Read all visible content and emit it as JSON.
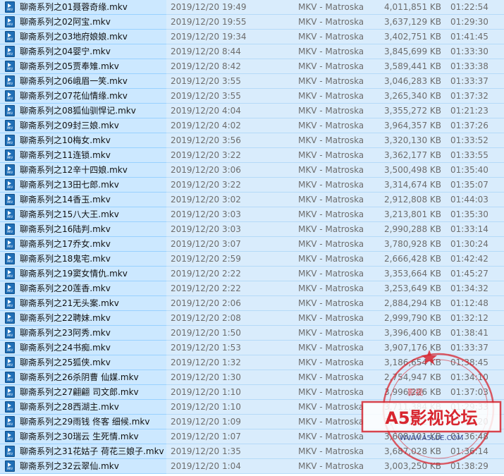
{
  "files": [
    {
      "name": "聊斋系列之01聂蓉奇缘.mkv",
      "date": "2019/12/20 19:49",
      "type": "MKV - Matroska",
      "size": "4,011,851 KB",
      "duration": "01:22:54"
    },
    {
      "name": "聊斋系列之02阿宝.mkv",
      "date": "2019/12/20 19:55",
      "type": "MKV - Matroska",
      "size": "3,637,129 KB",
      "duration": "01:29:30"
    },
    {
      "name": "聊斋系列之03地府娘娘.mkv",
      "date": "2019/12/20 19:34",
      "type": "MKV - Matroska",
      "size": "3,402,751 KB",
      "duration": "01:41:45"
    },
    {
      "name": "聊斋系列之04婴宁.mkv",
      "date": "2019/12/20 8:44",
      "type": "MKV - Matroska",
      "size": "3,845,699 KB",
      "duration": "01:33:30"
    },
    {
      "name": "聊斋系列之05贾奉雉.mkv",
      "date": "2019/12/20 8:42",
      "type": "MKV - Matroska",
      "size": "3,589,441 KB",
      "duration": "01:33:38"
    },
    {
      "name": "聊斋系列之06峨眉一笑.mkv",
      "date": "2019/12/20 3:55",
      "type": "MKV - Matroska",
      "size": "3,046,283 KB",
      "duration": "01:33:37"
    },
    {
      "name": "聊斋系列之07花仙情缘.mkv",
      "date": "2019/12/20 3:55",
      "type": "MKV - Matroska",
      "size": "3,265,340 KB",
      "duration": "01:37:32"
    },
    {
      "name": "聊斋系列之08狐仙驯悍记.mkv",
      "date": "2019/12/20 4:04",
      "type": "MKV - Matroska",
      "size": "3,355,272 KB",
      "duration": "01:21:23"
    },
    {
      "name": "聊斋系列之09封三娘.mkv",
      "date": "2019/12/20 4:02",
      "type": "MKV - Matroska",
      "size": "3,964,357 KB",
      "duration": "01:37:26"
    },
    {
      "name": "聊斋系列之10梅女.mkv",
      "date": "2019/12/20 3:56",
      "type": "MKV - Matroska",
      "size": "3,320,130 KB",
      "duration": "01:33:52"
    },
    {
      "name": "聊斋系列之11连锁.mkv",
      "date": "2019/12/20 3:22",
      "type": "MKV - Matroska",
      "size": "3,362,177 KB",
      "duration": "01:33:55"
    },
    {
      "name": "聊斋系列之12辛十四娘.mkv",
      "date": "2019/12/20 3:06",
      "type": "MKV - Matroska",
      "size": "3,500,498 KB",
      "duration": "01:35:40"
    },
    {
      "name": "聊斋系列之13田七郎.mkv",
      "date": "2019/12/20 3:22",
      "type": "MKV - Matroska",
      "size": "3,314,674 KB",
      "duration": "01:35:07"
    },
    {
      "name": "聊斋系列之14香玉.mkv",
      "date": "2019/12/20 3:02",
      "type": "MKV - Matroska",
      "size": "2,912,808 KB",
      "duration": "01:44:03"
    },
    {
      "name": "聊斋系列之15八大王.mkv",
      "date": "2019/12/20 3:03",
      "type": "MKV - Matroska",
      "size": "3,213,801 KB",
      "duration": "01:35:30"
    },
    {
      "name": "聊斋系列之16陆判.mkv",
      "date": "2019/12/20 3:03",
      "type": "MKV - Matroska",
      "size": "2,990,288 KB",
      "duration": "01:33:14"
    },
    {
      "name": "聊斋系列之17乔女.mkv",
      "date": "2019/12/20 3:07",
      "type": "MKV - Matroska",
      "size": "3,780,928 KB",
      "duration": "01:30:24"
    },
    {
      "name": "聊斋系列之18鬼宅.mkv",
      "date": "2019/12/20 2:59",
      "type": "MKV - Matroska",
      "size": "2,666,428 KB",
      "duration": "01:42:42"
    },
    {
      "name": "聊斋系列之19窦女情仇.mkv",
      "date": "2019/12/20 2:22",
      "type": "MKV - Matroska",
      "size": "3,353,664 KB",
      "duration": "01:45:27"
    },
    {
      "name": "聊斋系列之20莲香.mkv",
      "date": "2019/12/20 2:22",
      "type": "MKV - Matroska",
      "size": "3,253,649 KB",
      "duration": "01:34:32"
    },
    {
      "name": "聊斋系列之21无头案.mkv",
      "date": "2019/12/20 2:06",
      "type": "MKV - Matroska",
      "size": "2,884,294 KB",
      "duration": "01:12:48"
    },
    {
      "name": "聊斋系列之22聘妹.mkv",
      "date": "2019/12/20 2:08",
      "type": "MKV - Matroska",
      "size": "2,999,790 KB",
      "duration": "01:32:12"
    },
    {
      "name": "聊斋系列之23阿秀.mkv",
      "date": "2019/12/20 1:50",
      "type": "MKV - Matroska",
      "size": "3,396,400 KB",
      "duration": "01:38:41"
    },
    {
      "name": "聊斋系列之24书痴.mkv",
      "date": "2019/12/20 1:53",
      "type": "MKV - Matroska",
      "size": "3,907,176 KB",
      "duration": "01:33:37"
    },
    {
      "name": "聊斋系列之25狐侠.mkv",
      "date": "2019/12/20 1:32",
      "type": "MKV - Matroska",
      "size": "3,186,654 KB",
      "duration": "01:38:45"
    },
    {
      "name": "聊斋系列之26杀阴曹 仙媒.mkv",
      "date": "2019/12/20 1:30",
      "type": "MKV - Matroska",
      "size": "2,754,947 KB",
      "duration": "01:34:10"
    },
    {
      "name": "聊斋系列之27翩翩 司文郎.mkv",
      "date": "2019/12/20 1:10",
      "type": "MKV - Matroska",
      "size": "3,996,226 KB",
      "duration": "01:37:03"
    },
    {
      "name": "聊斋系列之28西湖主.mkv",
      "date": "2019/12/20 1:10",
      "type": "MKV - Matroska",
      "size": "3,711,384 KB",
      "duration": "01:29:33"
    },
    {
      "name": "聊斋系列之29雨钱 佟客 细候.mkv",
      "date": "2019/12/20 1:09",
      "type": "MKV - Matroska",
      "size": "3,436,422 KB",
      "duration": "01:36:20"
    },
    {
      "name": "聊斋系列之30瑞云 生死情.mkv",
      "date": "2019/12/20 1:07",
      "type": "MKV - Matroska",
      "size": "3,608,101 KB",
      "duration": "01:36:48"
    },
    {
      "name": "聊斋系列之31花姑子 荷花三娘子.mkv",
      "date": "2019/12/20 1:35",
      "type": "MKV - Matroska",
      "size": "3,687,028 KB",
      "duration": "01:36:14"
    },
    {
      "name": "聊斋系列之32云翠仙.mkv",
      "date": "2019/12/20 1:04",
      "type": "MKV - Matroska",
      "size": "3,003,250 KB",
      "duration": "01:38:29"
    }
  ],
  "icon": {
    "name": "mkv-file-icon",
    "tag": "MKV",
    "color": "#1f6fb7"
  },
  "watermark": {
    "top_text": "影视",
    "main_text": "A5影视论坛",
    "url": "WWW.A5LUE.COM",
    "color": "#d8262f"
  }
}
